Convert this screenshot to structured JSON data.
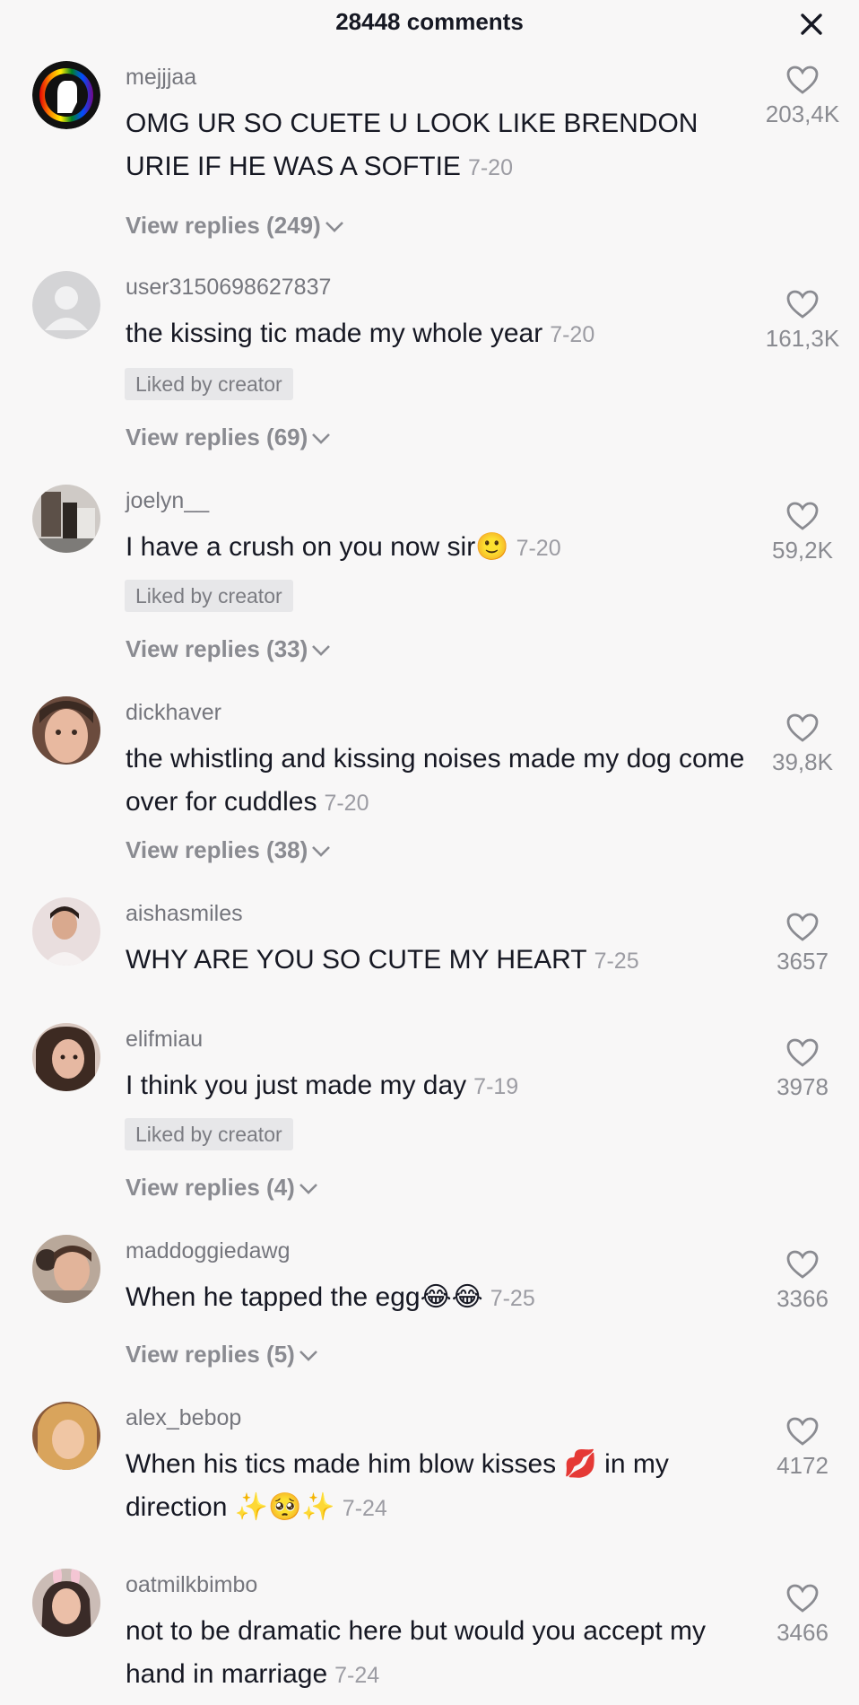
{
  "header": {
    "comment_count": "28448 comments",
    "close_icon": "close-icon"
  },
  "comments": [
    {
      "username": "mejjjaa",
      "text": "OMG UR SO CUETE U LOOK LIKE BRENDON URIE IF HE WAS A SOFTIE",
      "date": "7-20",
      "likes": "203,4K",
      "replies": "View replies (249)",
      "avatar": "raised-fist-pride-avatar"
    },
    {
      "username": "user3150698627837",
      "text": "the kissing tic made my whole year",
      "date": "7-20",
      "likes": "161,3K",
      "liked_by_creator": "Liked by creator",
      "replies": "View replies (69)",
      "avatar": "default-user-avatar"
    },
    {
      "username": "joelyn__",
      "text": "I have a crush on you now sir",
      "emoji": "🙂",
      "date": "7-20",
      "likes": "59,2K",
      "liked_by_creator": "Liked by creator",
      "replies": "View replies (33)",
      "avatar": "photo-avatar"
    },
    {
      "username": "dickhaver",
      "text": "the whistling and kissing noises made my dog come over for cuddles",
      "date": "7-20",
      "likes": "39,8K",
      "replies": "View replies (38)",
      "avatar": "photo-avatar"
    },
    {
      "username": "aishasmiles",
      "text": "WHY ARE YOU SO CUTE MY HEART",
      "date": "7-25",
      "likes": "3657",
      "avatar": "photo-avatar"
    },
    {
      "username": "elifmiau",
      "text": "I think you just made my day",
      "date": "7-19",
      "likes": "3978",
      "liked_by_creator": "Liked by creator",
      "replies": "View replies (4)",
      "avatar": "photo-avatar"
    },
    {
      "username": "maddoggiedawg",
      "text": "When he tapped the egg",
      "emoji": "😂😂",
      "date": "7-25",
      "likes": "3366",
      "replies": "View replies (5)",
      "avatar": "photo-avatar"
    },
    {
      "username": "alex_bebop",
      "text": "When his tics made him blow kisses 💋 in my direction ✨🥺✨",
      "date": "7-24",
      "likes": "4172",
      "avatar": "photo-avatar"
    },
    {
      "username": "oatmilkbimbo",
      "text": "not to be dramatic here but would you accept my hand in marriage",
      "date": "7-24",
      "likes": "3466",
      "avatar": "photo-avatar"
    }
  ]
}
